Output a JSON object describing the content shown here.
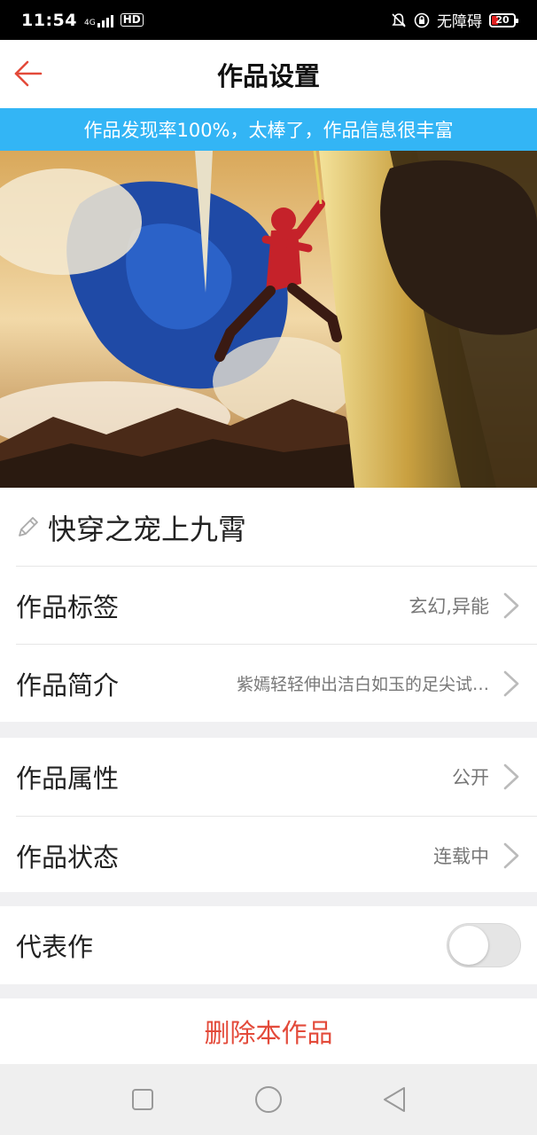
{
  "status_bar": {
    "time": "11:54",
    "network": "4G",
    "hd": "HD",
    "accessibility": "无障碍",
    "battery": "20"
  },
  "header": {
    "title": "作品设置",
    "back_icon": "arrow-left-icon"
  },
  "banner": {
    "text": "作品发现率100%，太棒了，作品信息很丰富"
  },
  "work": {
    "title": "快穿之宠上九霄",
    "edit_icon": "pencil-icon"
  },
  "rows": {
    "tags": {
      "label": "作品标签",
      "value": "玄幻,异能"
    },
    "intro": {
      "label": "作品简介",
      "value": "紫嫣轻轻伸出洁白如玉的足尖试…"
    },
    "attribute": {
      "label": "作品属性",
      "value": "公开"
    },
    "status": {
      "label": "作品状态",
      "value": "连载中"
    },
    "featured": {
      "label": "代表作",
      "enabled": false
    }
  },
  "actions": {
    "delete_label": "删除本作品"
  },
  "colors": {
    "accent_red": "#e34a3a",
    "banner_blue": "#33b5f5",
    "battery_low": "#e02020"
  },
  "system_nav": {
    "icons": [
      "square-recents-icon",
      "circle-home-icon",
      "triangle-back-icon"
    ]
  }
}
